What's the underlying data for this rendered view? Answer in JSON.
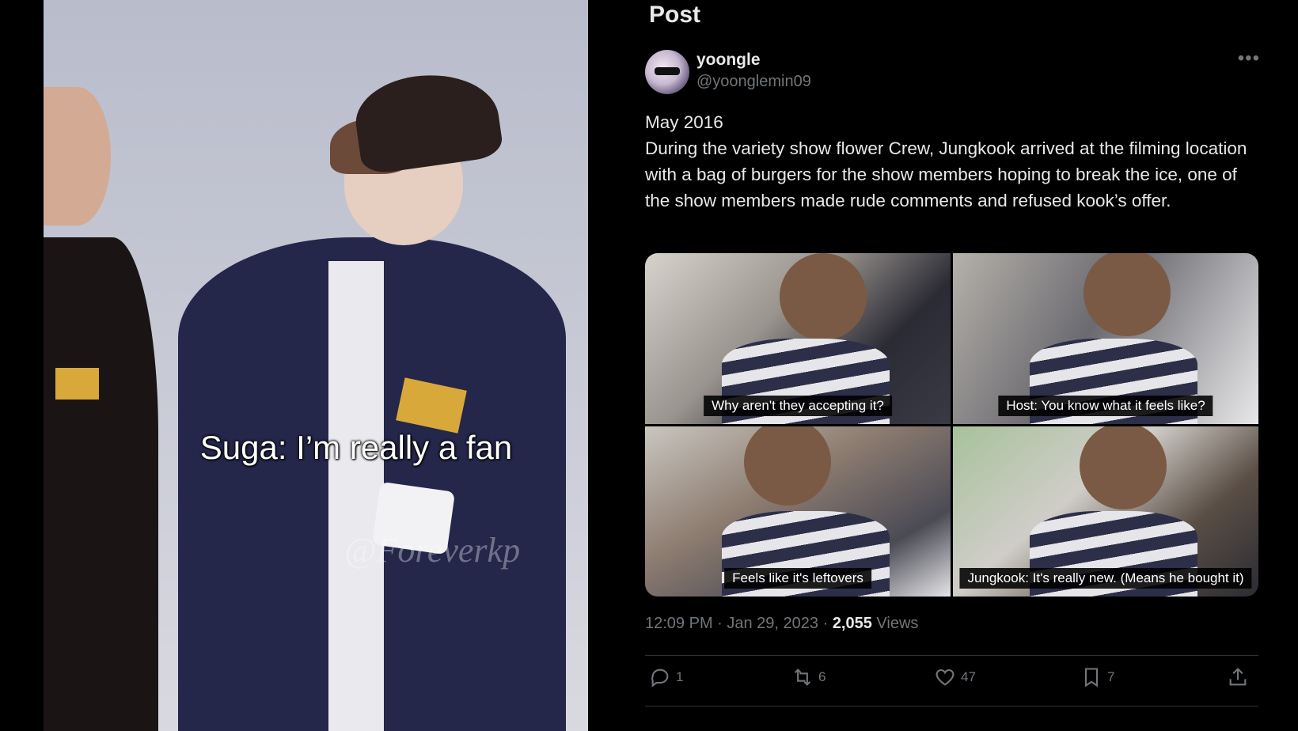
{
  "video": {
    "caption": "Suga:  I’m really a fan",
    "watermark": "@Foreverkp"
  },
  "tweet": {
    "header": "Post",
    "author_name": "yoongle",
    "author_handle": "@yoonglemin09",
    "more_icon": "more-horizontal-icon",
    "text": "May 2016\nDuring the variety show flower Crew, Jungkook arrived at the filming location with a bag of burgers for the show members hoping to break the ice, one of the show members made rude comments and refused kook’s offer.",
    "images": [
      {
        "caption": "Why aren't they accepting it?"
      },
      {
        "caption": "Host: You know what it feels like?"
      },
      {
        "caption": "Feels like it's leftovers"
      },
      {
        "caption": "Jungkook: It's really new. (Means he bought it)"
      }
    ],
    "timestamp": "12:09 PM · Jan 29, 2023 · ",
    "views_count": "2,055",
    "views_label": " Views",
    "actions": {
      "replies": "1",
      "reposts": "6",
      "likes": "47",
      "bookmarks": "7"
    }
  },
  "colors": {
    "background": "#000000",
    "text_primary": "#e7e9ea",
    "text_secondary": "#71767b",
    "divider": "#2f3336"
  }
}
